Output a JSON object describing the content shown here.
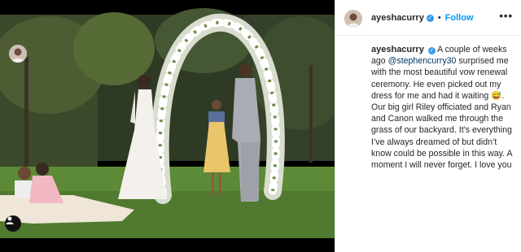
{
  "post": {
    "username": "ayeshacurry",
    "separator": "•",
    "follow_label": "Follow",
    "more_label": "•••",
    "caption_mention": "@stephencurry30",
    "caption_before": "A couple of weeks ago",
    "caption_after": "surprised me with the most beautiful vow renewal ceremony. He even picked out my dress for me and had it waiting 😅. Our big girl Riley officiated and Ryan and Canon walked me through the grass of our backyard. It’s everything I’ve always dreamed of but didn’t know could be possible in this way. A moment I will never forget. I love you"
  },
  "icons": {
    "verified": "verified-badge-icon",
    "user_tag": "user-tag-icon",
    "more": "more-options-icon"
  },
  "colors": {
    "link": "#0095f6",
    "verified": "#3897f0",
    "text": "#262626"
  }
}
